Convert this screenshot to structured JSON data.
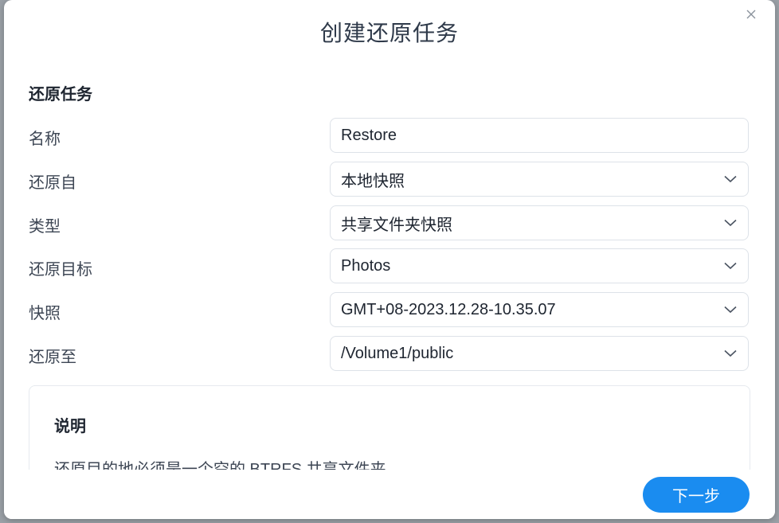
{
  "dialog": {
    "title": "创建还原任务",
    "section_title": "还原任务"
  },
  "form": {
    "rows": [
      {
        "label": "名称",
        "value": "Restore",
        "type": "text"
      },
      {
        "label": "还原自",
        "value": "本地快照",
        "type": "select"
      },
      {
        "label": "类型",
        "value": "共享文件夹快照",
        "type": "select"
      },
      {
        "label": "还原目标",
        "value": "Photos",
        "type": "select"
      },
      {
        "label": "快照",
        "value": "GMT+08-2023.12.28-10.35.07",
        "type": "select"
      },
      {
        "label": "还原至",
        "value": "/Volume1/public",
        "type": "select"
      }
    ]
  },
  "note": {
    "title": "说明",
    "text": "还原目的地必须是一个空的 BTRFS 共享文件夹"
  },
  "footer": {
    "next_label": "下一步"
  },
  "colors": {
    "accent": "#1a8cf0",
    "border": "#dde2e8"
  },
  "icons": {
    "close": "close-icon",
    "dropdown": "chevron-down-icon"
  }
}
